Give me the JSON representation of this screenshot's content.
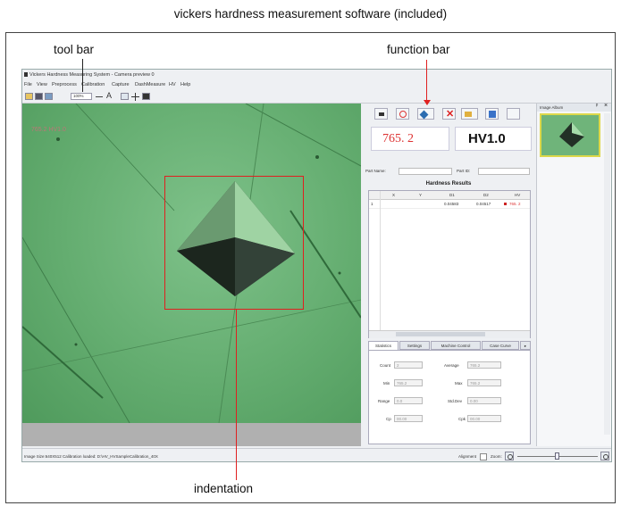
{
  "captions": {
    "title": "vickers hardness measurement software (included)",
    "tool_bar": "tool bar",
    "function_bar": "function bar",
    "indentation": "indentation"
  },
  "app": {
    "window_title": "Vickers Hardness Measuring System - Camera preview 0",
    "menu": [
      "File",
      "View",
      "Preprocess",
      "Calibration",
      "Capture",
      "DashMeasure",
      "HV",
      "Help"
    ],
    "toolbar": {
      "zoom_value": "100%",
      "text_tool": "A"
    },
    "overlay_value": "765.2 HV1.0",
    "hardness_value": "765. 2",
    "hardness_scale": "HV1.0",
    "part_name_label": "Part Name:",
    "part_id_label": "Part ID:",
    "results_title": "Hardness Results",
    "table_headers": [
      "",
      "X",
      "Y",
      "D1",
      "D2",
      "HV"
    ],
    "table_rows": [
      [
        "1",
        "",
        "",
        "0.04583",
        "0.04517",
        "765. 2"
      ]
    ],
    "tabs": [
      "Statistics",
      "Settings",
      "Machine Control",
      "Case Curve"
    ],
    "stats": {
      "count_label": "Count",
      "count_value": "2",
      "average_label": "Average",
      "average_value": "765.2",
      "min_label": "Min",
      "min_value": "765.2",
      "max_label": "Max",
      "max_value": "765.2",
      "range_label": "Range",
      "range_value": "0.0",
      "stddev_label": "Std.Dev",
      "stddev_value": "0.00",
      "cp_label": "Cp",
      "cp_value": "00.00",
      "cpk_label": "Cpk",
      "cpk_value": "00.00"
    },
    "album_title": "Image Album",
    "status_text": "Image Size:640X512  Calibration loaded: D:\\HV_HVSampleCalibration_40X",
    "alignment_label": "Alignment",
    "zoom_label": "Zoom:"
  }
}
